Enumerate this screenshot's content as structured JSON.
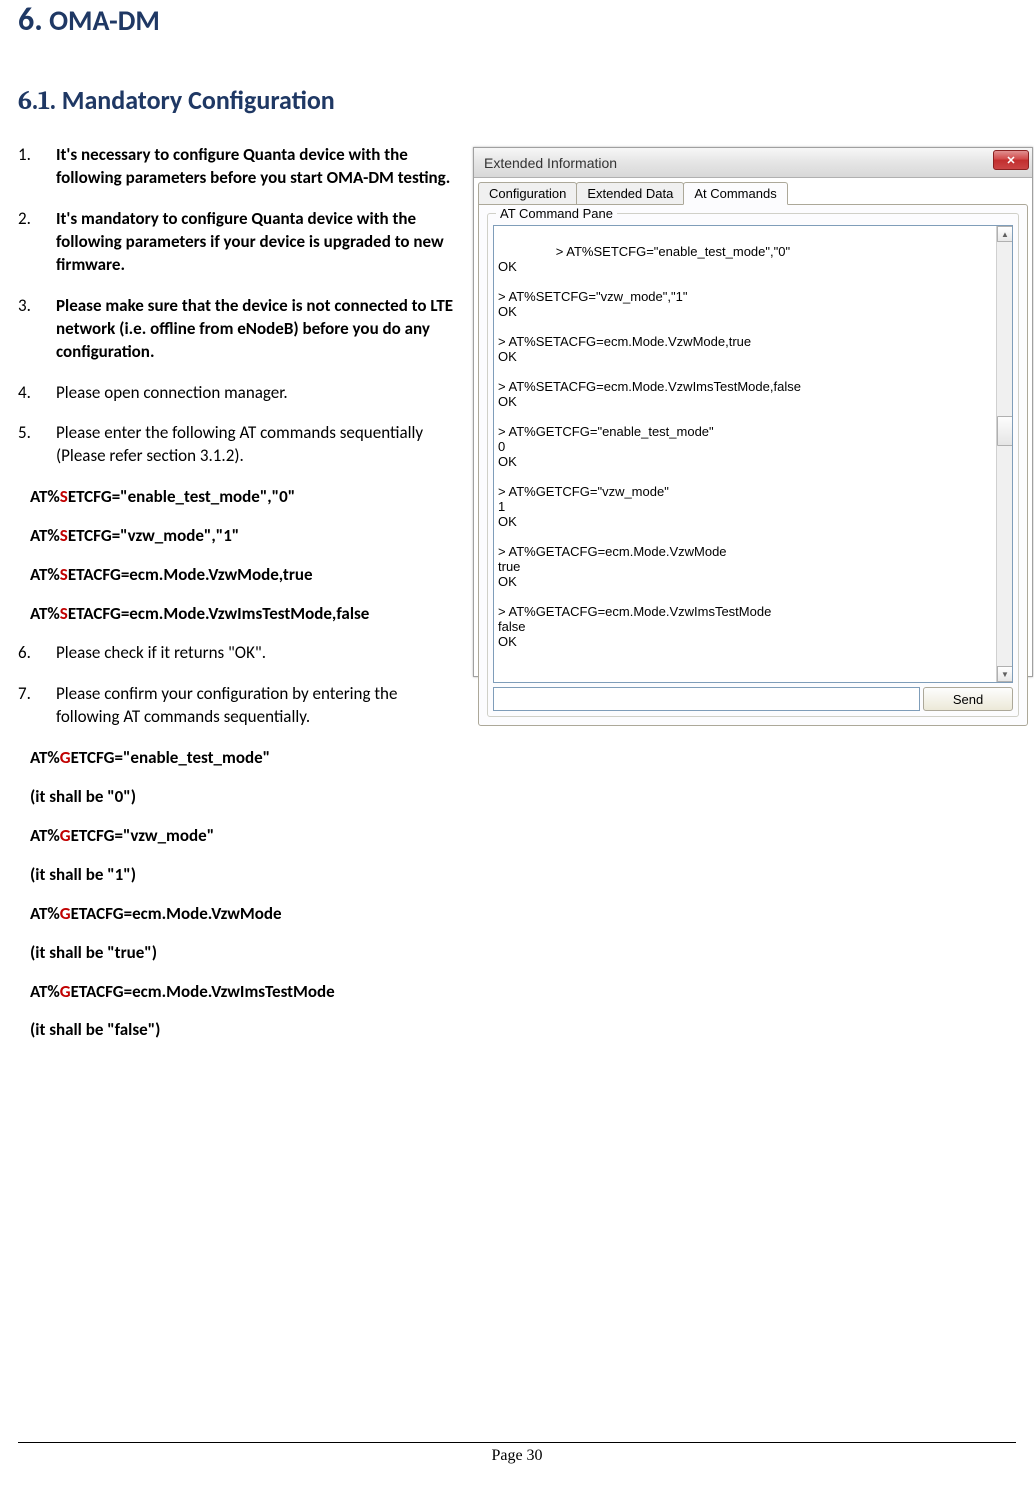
{
  "chapter": {
    "number": "6.",
    "title": "OMA-DM"
  },
  "section": {
    "number": "6.1.",
    "title": "Mandatory Configuration"
  },
  "steps": {
    "s1": {
      "num": "1.",
      "text": "It's necessary to configure Quanta device with the following parameters before you start OMA-DM testing"
    },
    "s2": {
      "num": "2.",
      "text": "It's mandatory to configure Quanta device with the following parameters if your device is upgraded to new firmware."
    },
    "s3": {
      "num": "3.",
      "text_a": "Please make sure that the device is not connected to LTE network (i.e. offline from eNodeB) before you do any configuration"
    },
    "s4": {
      "num": "4.",
      "text": "Please open connection manager."
    },
    "s5": {
      "num": "5.",
      "text": "Please enter the following AT commands sequentially (Please refer section 3.1.2)."
    },
    "s6": {
      "num": "6.",
      "text": "Please check if it returns \"OK\"."
    },
    "s7": {
      "num": "7.",
      "text": "Please confirm your configuration by entering the following AT commands sequentially."
    }
  },
  "at_set": {
    "c1_pre": "AT%",
    "c1_letter": "S",
    "c1_post": "ETCFG=\"enable_test_mode\",\"0\"",
    "c2_pre": "AT%",
    "c2_letter": "S",
    "c2_post": "ETCFG=\"vzw_mode\",\"1\"",
    "c3_pre": "AT%",
    "c3_letter": "S",
    "c3_post": "ETACFG=ecm.Mode.VzwMode,true",
    "c4_pre": "AT%",
    "c4_letter": "S",
    "c4_post": "ETACFG=ecm.Mode.VzwImsTestMode,false"
  },
  "at_get": {
    "c1_pre": "AT%",
    "c1_letter": "G",
    "c1_post": "ETCFG=\"enable_test_mode\"",
    "r1": "(it shall be \"0\")",
    "c2_pre": "AT%",
    "c2_letter": "G",
    "c2_post": "ETCFG=\"vzw_mode\"",
    "r2": "(it shall be \"1\")",
    "c3_pre": "AT%",
    "c3_letter": "G",
    "c3_post": "ETACFG=ecm.Mode.VzwMode",
    "r3": "(it shall be \"true\")",
    "c4_pre": "AT%",
    "c4_letter": "G",
    "c4_post": "ETACFG=ecm.Mode.VzwImsTestMode",
    "r4": "(it shall be \"false\")"
  },
  "window": {
    "title": "Extended Information",
    "tab1": "Configuration",
    "tab2": "Extended Data",
    "tab3": "At Commands",
    "pane_label": "AT Command Pane",
    "output": "> AT%SETCFG=\"enable_test_mode\",\"0\"\nOK\n\n> AT%SETCFG=\"vzw_mode\",\"1\"\nOK\n\n> AT%SETACFG=ecm.Mode.VzwMode,true\nOK\n\n> AT%SETACFG=ecm.Mode.VzwImsTestMode,false\nOK\n\n> AT%GETCFG=\"enable_test_mode\"\n0\nOK\n\n> AT%GETCFG=\"vzw_mode\"\n1\nOK\n\n> AT%GETACFG=ecm.Mode.VzwMode\ntrue\nOK\n\n> AT%GETACFG=ecm.Mode.VzwImsTestMode\nfalse\nOK",
    "send": "Send"
  },
  "footer": "Page 30"
}
